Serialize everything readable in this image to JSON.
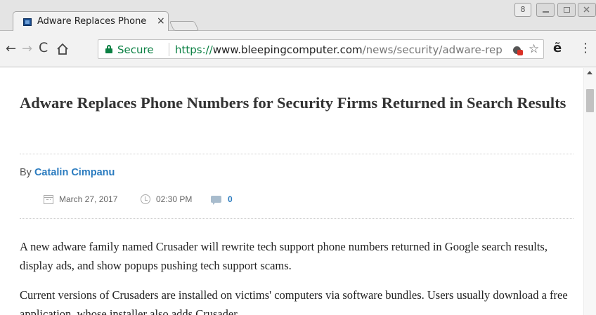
{
  "tab": {
    "title": "Adware Replaces Phone Numbers for Security Firms",
    "close_glyph": "×"
  },
  "window_buttons": {
    "profile_glyph": "8"
  },
  "toolbar": {
    "back_glyph": "←",
    "forward_glyph": "→",
    "reload_glyph": "C",
    "star_glyph": "☆",
    "extension_glyph": "ẽ",
    "menu_glyph": "⋮"
  },
  "omnibox": {
    "security_label": "Secure",
    "url_scheme": "https://",
    "url_host": "www.bleepingcomputer.com",
    "url_path": "/news/security/adware-replaces-phone-numbers-for-security-firms-returned-in-search-results/"
  },
  "article": {
    "headline": "Adware Replaces Phone Numbers for Security Firms Returned in Search Results",
    "by_label": "By",
    "author": "Catalin Cimpanu",
    "date": "March 27, 2017",
    "time": "02:30 PM",
    "comment_count": "0",
    "paragraphs": [
      "A new adware family named Crusader will rewrite tech support phone numbers returned in Google search results, display ads, and show popups pushing tech support scams.",
      "Current versions of Crusaders are installed on victims' computers via software bundles. Users usually download a free application, whose installer also adds Crusader."
    ]
  },
  "colors": {
    "secure_green": "#0b8043",
    "link_blue": "#2a7bbf",
    "headline_text": "#333333"
  },
  "icons": [
    "favicon-bleepingcomputer",
    "tab-close-icon",
    "profile-icon",
    "minimize-icon",
    "maximize-icon",
    "window-close-icon",
    "back-arrow-icon",
    "forward-arrow-icon",
    "reload-icon",
    "home-icon",
    "lock-icon",
    "site-settings-icon",
    "bookmark-star-icon",
    "extension-icon",
    "chrome-menu-icon",
    "calendar-icon",
    "clock-icon",
    "comment-icon"
  ]
}
